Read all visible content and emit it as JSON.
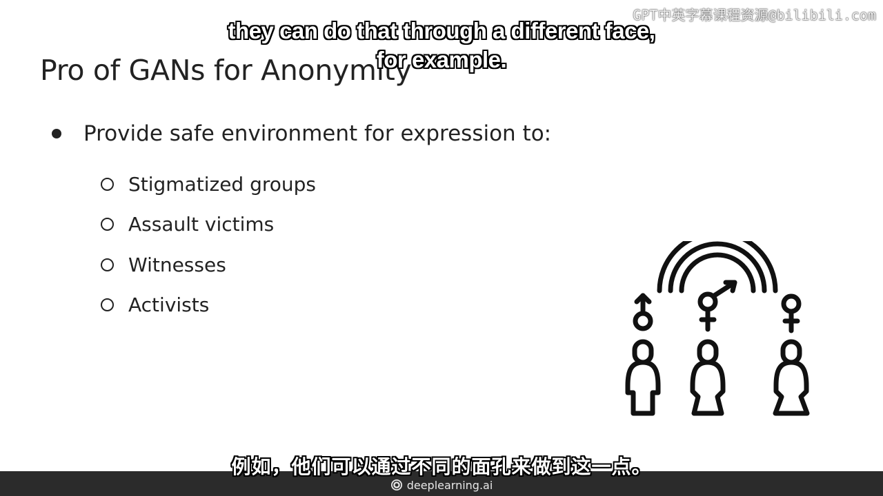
{
  "slide": {
    "title": "Pro of GANs for Anonymity",
    "bullet": "Provide safe environment for expression to:",
    "sub_items": [
      "Stigmatized groups",
      "Assault victims",
      "Witnesses",
      "Activists"
    ]
  },
  "subtitles": {
    "english_line1": "they can do that through a different face,",
    "english_line2": "for example.",
    "chinese": "例如，他们可以通过不同的面孔来做到这一点。"
  },
  "watermark": "GPT中英字幕课程资源@bilibili.com",
  "footer": {
    "brand": "deeplearning.ai"
  },
  "illustration": {
    "icons": [
      "rainbow-icon",
      "male-symbol-icon",
      "transgender-symbol-icon",
      "female-symbol-icon",
      "person-icon",
      "person-icon",
      "person-icon"
    ]
  },
  "colors": {
    "text": "#222222",
    "footer_bg": "#2b2b2b",
    "subtitle_text": "#ffffff"
  }
}
